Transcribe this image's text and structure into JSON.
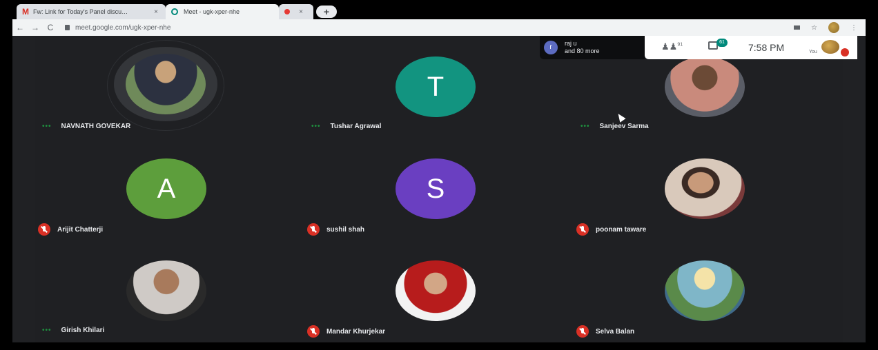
{
  "browser": {
    "tabs": [
      {
        "title": "Fw: Link for Today's Panel discu…",
        "close": "×",
        "icon": "gmail-icon"
      },
      {
        "title": "Meet - ugk-xper-nhe",
        "close": "×",
        "icon": "meet-icon"
      },
      {
        "title": "",
        "close": "×",
        "icon": "recording-dot-icon"
      }
    ],
    "new_tab": "+",
    "nav": {
      "back": "←",
      "forward": "→",
      "reload": "C"
    },
    "url": "meet.google.com/ugk-xper-nhe",
    "star": "☆",
    "menu": "⋮"
  },
  "meet": {
    "presenter_initial": "r",
    "presenter_name": "raj u",
    "presenter_more": "and 80 more",
    "people_count": "91",
    "chat_count": "61",
    "time": "7:58 PM",
    "you_label": "You"
  },
  "participants": [
    {
      "name": "NAVNATH GOVEKAR",
      "status": "speaking",
      "avatar": "photo",
      "color": "#556b4a"
    },
    {
      "name": "Tushar Agrawal",
      "status": "speaking",
      "avatar": "letter",
      "letter": "T",
      "color": "#129480"
    },
    {
      "name": "Sanjeev Sarma",
      "status": "speaking",
      "avatar": "photo",
      "color": "#c98a7c"
    },
    {
      "name": "Arijit Chatterji",
      "status": "muted",
      "avatar": "letter",
      "letter": "A",
      "color": "#5d9e3c"
    },
    {
      "name": "sushil shah",
      "status": "muted",
      "avatar": "letter",
      "letter": "S",
      "color": "#6a3fc1"
    },
    {
      "name": "poonam taware",
      "status": "muted",
      "avatar": "photo",
      "color": "#d9c9bb"
    },
    {
      "name": "Girish Khilari",
      "status": "speaking",
      "avatar": "photo",
      "color": "#cfcac6"
    },
    {
      "name": "Mandar Khurjekar",
      "status": "muted",
      "avatar": "photo",
      "color": "#b71c1c"
    },
    {
      "name": "Selva Balan",
      "status": "muted",
      "avatar": "photo",
      "color": "#7fb6c8"
    }
  ],
  "speaking_indicator": "•••"
}
